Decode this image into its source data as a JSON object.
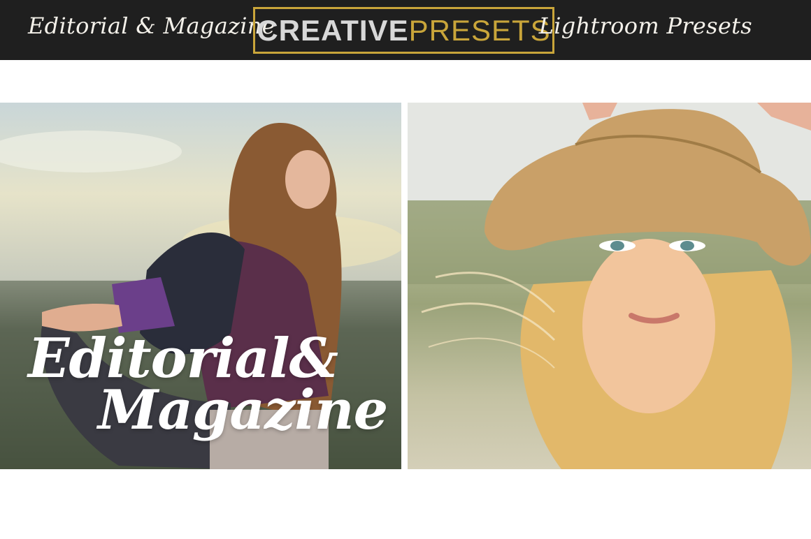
{
  "header": {
    "left_title": "Editorial & Magazine",
    "logo": {
      "part1": "CREATIVE",
      "part2": "PRESETS"
    },
    "right_title": "Lightroom Presets"
  },
  "left_panel": {
    "overlay_line1": "Editorial&",
    "overlay_line2": "Magazine"
  },
  "colors": {
    "header_bg": "#1f1f1f",
    "gold_accent": "#c9a53a",
    "logo_grey": "#d8d8d8"
  }
}
